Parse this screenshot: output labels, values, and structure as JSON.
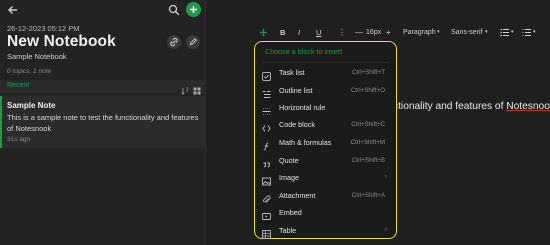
{
  "sidebar": {
    "date": "26-12-2023 05:12 PM",
    "title": "New Notebook",
    "description": "Sample Notebook",
    "meta": "0 topics, 1 note",
    "recent_label": "Recent",
    "note": {
      "title": "Sample Note",
      "preview": "This is a sample note to test the functionality and features of Notesnook",
      "time": "31s ago"
    }
  },
  "toolbar": {
    "bold": "B",
    "italic": "I",
    "underline": "U",
    "more": "⋮",
    "minus": "—",
    "font_size": "16px",
    "plus": "+",
    "paragraph": "Paragraph",
    "font": "Sans-serif",
    "caret": "▾"
  },
  "editor": {
    "visible_text": "ctionality and features of ",
    "link_text": "Notesnook"
  },
  "menu": {
    "header": "Choose a block to insert",
    "items": [
      {
        "label": "Task list",
        "shortcut": "Ctrl+Shift+T",
        "icon": "task-list-icon",
        "arrow": ""
      },
      {
        "label": "Outline list",
        "shortcut": "Ctrl+Shift+O",
        "icon": "outline-list-icon",
        "arrow": ""
      },
      {
        "label": "Horizontal rule",
        "shortcut": "",
        "icon": "horizontal-rule-icon",
        "arrow": ""
      },
      {
        "label": "Code block",
        "shortcut": "Ctrl+Shift+C",
        "icon": "code-block-icon",
        "arrow": ""
      },
      {
        "label": "Math & formulas",
        "shortcut": "Ctrl+Shift+M",
        "icon": "math-icon",
        "arrow": ""
      },
      {
        "label": "Quote",
        "shortcut": "Ctrl+Shift+B",
        "icon": "quote-icon",
        "arrow": ""
      },
      {
        "label": "Image",
        "shortcut": "",
        "icon": "image-icon",
        "arrow": "›"
      },
      {
        "label": "Attachment",
        "shortcut": "Ctrl+Shift+A",
        "icon": "attachment-icon",
        "arrow": ""
      },
      {
        "label": "Embed",
        "shortcut": "",
        "icon": "embed-icon",
        "arrow": ""
      },
      {
        "label": "Table",
        "shortcut": "",
        "icon": "table-icon",
        "arrow": "›"
      }
    ]
  },
  "colors": {
    "accent": "#1e9b46",
    "highlight": "#e8e030"
  }
}
